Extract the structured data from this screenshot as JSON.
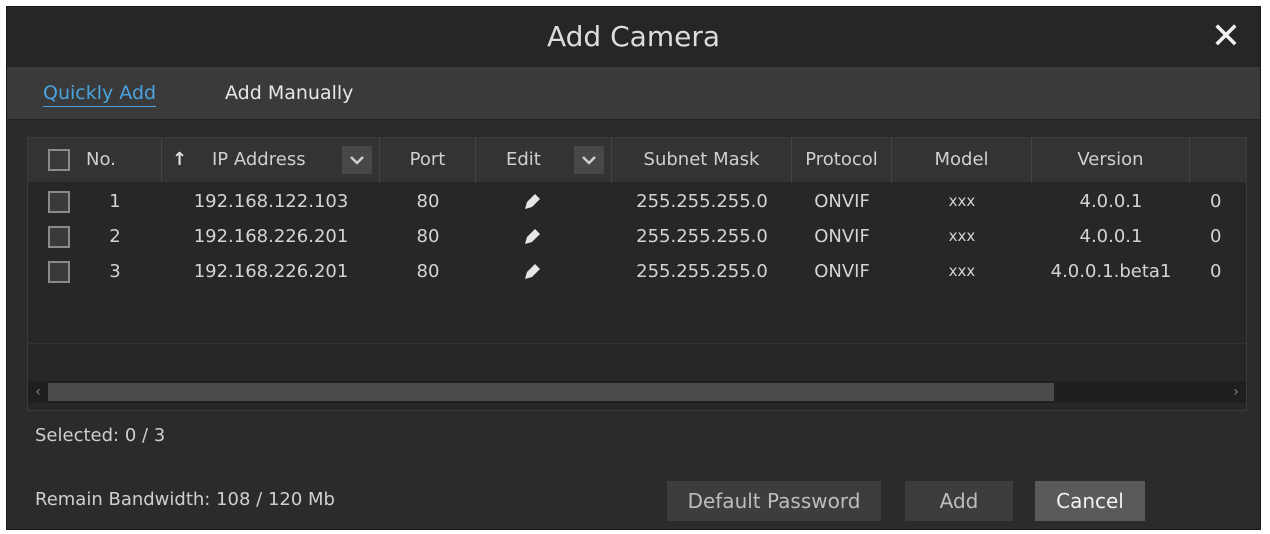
{
  "dialog": {
    "title": "Add Camera"
  },
  "tabs": [
    {
      "label": "Quickly Add",
      "active": true
    },
    {
      "label": "Add Manually",
      "active": false
    }
  ],
  "table": {
    "headers": {
      "no": "No.",
      "ip": "IP Address",
      "port": "Port",
      "edit": "Edit",
      "subnet": "Subnet Mask",
      "protocol": "Protocol",
      "model": "Model",
      "version": "Version"
    },
    "sort_arrow": "↑",
    "rows": [
      {
        "no": "1",
        "ip": "192.168.122.103",
        "port": "80",
        "subnet": "255.255.255.0",
        "protocol": "ONVIF",
        "model": "xxx",
        "version": "4.0.0.1",
        "extra": "0"
      },
      {
        "no": "2",
        "ip": "192.168.226.201",
        "port": "80",
        "subnet": "255.255.255.0",
        "protocol": "ONVIF",
        "model": "xxx",
        "version": "4.0.0.1",
        "extra": "0"
      },
      {
        "no": "3",
        "ip": "192.168.226.201",
        "port": "80",
        "subnet": "255.255.255.0",
        "protocol": "ONVIF",
        "model": "xxx",
        "version": "4.0.0.1.beta1",
        "extra": "0"
      }
    ]
  },
  "status": {
    "selected": "Selected: 0 / 3",
    "bandwidth": "Remain Bandwidth: 108 / 120 Mb"
  },
  "buttons": {
    "default_password": "Default Password",
    "add": "Add",
    "cancel": "Cancel"
  },
  "icons": {
    "close": "close-icon",
    "edit": "pencil-icon",
    "dropdown": "chevron-down-icon"
  },
  "colors": {
    "accent": "#4aa3df",
    "background": "#2b2b2b"
  }
}
